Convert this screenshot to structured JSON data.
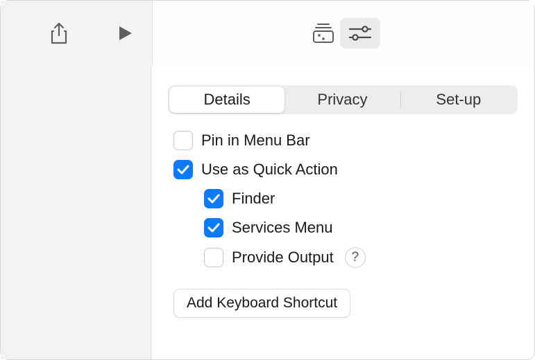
{
  "tabs": {
    "details": "Details",
    "privacy": "Privacy",
    "setup": "Set-up",
    "active": "details"
  },
  "options": {
    "pin_menu_bar": {
      "label": "Pin in Menu Bar",
      "checked": false
    },
    "quick_action": {
      "label": "Use as Quick Action",
      "checked": true
    },
    "finder": {
      "label": "Finder",
      "checked": true
    },
    "services_menu": {
      "label": "Services Menu",
      "checked": true
    },
    "provide_output": {
      "label": "Provide Output",
      "checked": false
    }
  },
  "buttons": {
    "add_shortcut": "Add Keyboard Shortcut"
  },
  "help": "?"
}
